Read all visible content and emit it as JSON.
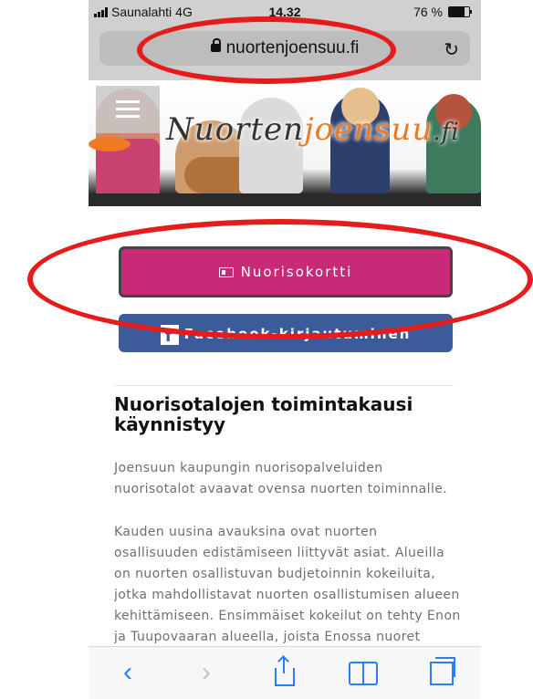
{
  "status_bar": {
    "carrier": "Saunalahti",
    "network": "4G",
    "time": "14.32",
    "battery": "76 %",
    "battery_level": 0.76
  },
  "browser": {
    "url": "nuortenjoensuu.fi"
  },
  "banner": {
    "logo_part1": "Nuorten",
    "logo_part2": "joensuu",
    "logo_part3": ".fi"
  },
  "buttons": {
    "nuorisokortti": "Nuorisokortti",
    "facebook_login": "Facebook-kirjautuminen"
  },
  "post": {
    "title": "Nuorisotalojen toimintakausi käynnistyy",
    "paragraph1": "Joensuun kaupungin nuorisopalveluiden nuorisotalot avaavat ovensa nuorten toiminnalle.",
    "paragraph2": "Kauden uusina avauksina ovat nuorten osallisuuden edistämiseen liittyvät asiat. Alueilla on nuorten osallistuvan budjetoinnin kokeiluita, jotka mahdollistavat nuorten osallistumisen alueen kehittämiseen. Ensimmäiset kokeilut on tehty Enon ja Tuupovaaran alueella, joista Enossa nuoret"
  },
  "colors": {
    "accent": "#c82a77",
    "facebook": "#3b5b9a",
    "ios_blue": "#2f7df6",
    "annotation": "#e51c1c"
  },
  "icons": [
    "lock-icon",
    "reload-icon",
    "menu-icon",
    "id-card-icon",
    "facebook-icon",
    "back-icon",
    "forward-icon",
    "share-icon",
    "bookmarks-icon",
    "tabs-icon"
  ]
}
